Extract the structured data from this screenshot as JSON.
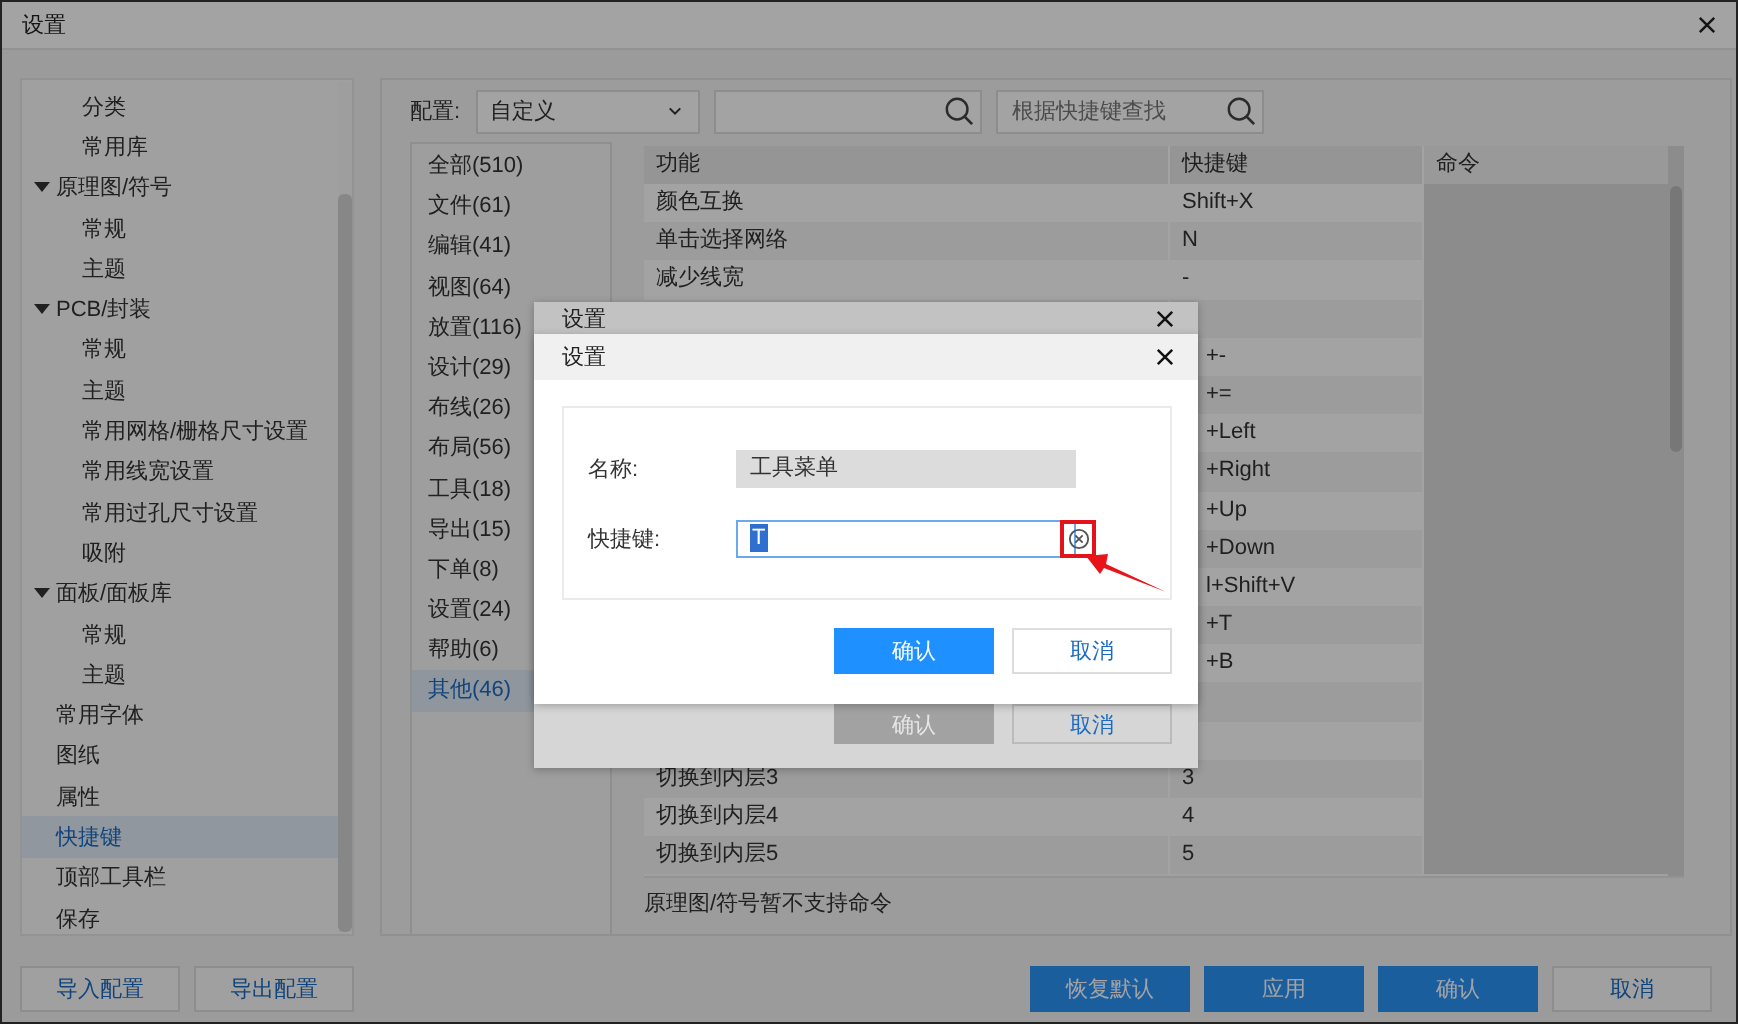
{
  "window": {
    "title": "设置"
  },
  "sidebar": {
    "items": [
      {
        "children": [
          {
            "label": "分类",
            "selected": false
          },
          {
            "label": "常用库",
            "selected": false
          }
        ]
      },
      {
        "label": "原理图/符号",
        "selected": false,
        "expanded": true,
        "children": [
          {
            "label": "常规",
            "selected": false
          },
          {
            "label": "主题",
            "selected": false
          }
        ]
      },
      {
        "label": "PCB/封装",
        "selected": false,
        "expanded": true,
        "children": [
          {
            "label": "常规",
            "selected": false
          },
          {
            "label": "主题",
            "selected": false
          },
          {
            "label": "常用网格/栅格尺寸设置",
            "selected": false
          },
          {
            "label": "常用线宽设置",
            "selected": false
          },
          {
            "label": "常用过孔尺寸设置",
            "selected": false
          },
          {
            "label": "吸附",
            "selected": false
          }
        ]
      },
      {
        "label": "面板/面板库",
        "selected": false,
        "expanded": true,
        "children": [
          {
            "label": "常规",
            "selected": false
          },
          {
            "label": "主题",
            "selected": false
          }
        ]
      },
      {
        "label": "常用字体",
        "selected": false
      },
      {
        "label": "图纸",
        "selected": false
      },
      {
        "label": "属性",
        "selected": false
      },
      {
        "label": "快捷键",
        "selected": true
      },
      {
        "label": "顶部工具栏",
        "selected": false
      },
      {
        "label": "保存",
        "selected": false
      }
    ]
  },
  "config_buttons": [
    "导入配置",
    "导出配置"
  ],
  "config": {
    "label": "配置:",
    "value": "自定义"
  },
  "shortcut_search": {
    "placeholder": "根据快捷键查找"
  },
  "categories": [
    {
      "label": "全部(510)",
      "selected": false
    },
    {
      "label": "文件(61)",
      "selected": false
    },
    {
      "label": "编辑(41)",
      "selected": false
    },
    {
      "label": "视图(64)",
      "selected": false
    },
    {
      "label": "放置(116)",
      "selected": false
    },
    {
      "label": "设计(29)",
      "selected": false
    },
    {
      "label": "布线(26)",
      "selected": false
    },
    {
      "label": "布局(56)",
      "selected": false
    },
    {
      "label": "工具(18)",
      "selected": false
    },
    {
      "label": "导出(15)",
      "selected": false
    },
    {
      "label": "下单(8)",
      "selected": false
    },
    {
      "label": "设置(24)",
      "selected": false
    },
    {
      "label": "帮助(6)",
      "selected": false
    },
    {
      "label": "其他(46)",
      "selected": true
    }
  ],
  "table": {
    "columns": [
      "功能",
      "快捷键",
      "命令"
    ],
    "rows": [
      {
        "function": "颜色互换",
        "shortcut": "Shift+X"
      },
      {
        "function": "单击选择网络",
        "shortcut": "N"
      },
      {
        "function": "减少线宽",
        "shortcut": "-"
      },
      {},
      {
        "shortcut": "+-"
      },
      {
        "shortcut": "+="
      },
      {
        "shortcut": "+Left"
      },
      {
        "shortcut": "+Right"
      },
      {
        "shortcut": "+Up"
      },
      {
        "shortcut": "+Down"
      },
      {
        "shortcut": "l+Shift+V"
      },
      {
        "shortcut": "+T"
      },
      {
        "shortcut": "+B"
      },
      {},
      {},
      {
        "function": "切换到内层3",
        "shortcut": "3"
      },
      {
        "function": "切换到内层4",
        "shortcut": "4"
      },
      {
        "function": "切换到内层5",
        "shortcut": "5"
      }
    ]
  },
  "note": "原理图/符号暂不支持命令",
  "footer_buttons": [
    {
      "label": "恢复默认",
      "kind": "primary"
    },
    {
      "label": "应用",
      "kind": "primary"
    },
    {
      "label": "确认",
      "kind": "primary"
    },
    {
      "label": "取消",
      "kind": "default"
    }
  ],
  "dialog_back": {
    "title": "设置",
    "buttons": [
      {
        "label": "确认",
        "disabled": true
      },
      {
        "label": "取消",
        "disabled": false
      }
    ]
  },
  "dialog": {
    "title": "设置",
    "fields": [
      {
        "label": "名称:",
        "value": "工具菜单",
        "kind": "readonly"
      },
      {
        "label": "快捷键:",
        "value": "T",
        "kind": "shortcut"
      }
    ],
    "buttons": [
      {
        "label": "确认",
        "kind": "primary"
      },
      {
        "label": "取消",
        "kind": "default"
      }
    ]
  }
}
